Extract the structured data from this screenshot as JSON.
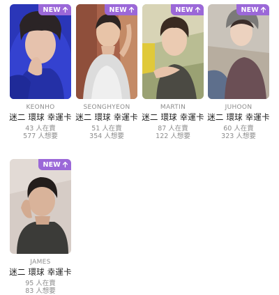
{
  "products": [
    {
      "badge": "NEW",
      "name": "KEONHO",
      "title": "迷二 環球 幸運卡",
      "sellers": "43 人在賣",
      "wants": "577 人想要",
      "arrow_icon": "arrow-up-icon"
    },
    {
      "badge": "NEW",
      "name": "SEONGHYEON",
      "title": "迷二 環球 幸運卡",
      "sellers": "51 人在賣",
      "wants": "354 人想要",
      "arrow_icon": "arrow-up-icon"
    },
    {
      "badge": "NEW",
      "name": "MARTIN",
      "title": "迷二 環球 幸運卡",
      "sellers": "87 人在賣",
      "wants": "122 人想要",
      "arrow_icon": "arrow-up-icon"
    },
    {
      "badge": "NEW",
      "name": "JUHOON",
      "title": "迷二 環球 幸運卡",
      "sellers": "60 人在賣",
      "wants": "323 人想要",
      "arrow_icon": "arrow-up-icon"
    },
    {
      "badge": "NEW",
      "name": "JAMES",
      "title": "迷二 環球 幸運卡",
      "sellers": "95 人在賣",
      "wants": "83 人想要",
      "arrow_icon": "arrow-up-icon"
    }
  ],
  "colors": {
    "badge": "#9b68d8",
    "name": "#8c8c8c",
    "title": "#1d1d1d",
    "stats": "#8c8c8c"
  }
}
